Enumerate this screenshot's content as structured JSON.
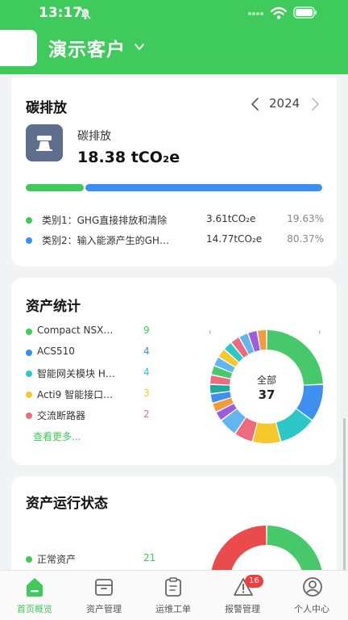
{
  "status_bar": {
    "time": "13:17",
    "icons": [
      "bell-off-icon",
      "signal-dots-icon",
      "wifi-icon",
      "battery-icon"
    ]
  },
  "header": {
    "org_name": "演示客户",
    "bg_color": "#3fcb5b"
  },
  "carbon": {
    "title": "碳排放",
    "year": "2024",
    "label": "碳排放",
    "value": "18.38 tCO₂e",
    "categories": [
      {
        "name": "类别1：GHG直接排放和清除",
        "value": "3.61tCO₂e",
        "percent": "19.63%",
        "share": 0.1963,
        "color": "#3fcb5b"
      },
      {
        "name": "类别2：输入能源产生的GH…",
        "value": "14.77tCO₂e",
        "percent": "80.37%",
        "share": 0.8037,
        "color": "#3b8ff0"
      }
    ]
  },
  "asset_stats": {
    "title": "资产统计",
    "items": [
      {
        "name": "Compact NSX…",
        "count": "9",
        "color": "#3fcb5b"
      },
      {
        "name": "ACS510",
        "count": "4",
        "color": "#3b8ff0"
      },
      {
        "name": "智能网关模块 H…",
        "count": "4",
        "color": "#2cc8c8"
      },
      {
        "name": "Acti9 智能接口…",
        "count": "3",
        "color": "#f5c82b"
      },
      {
        "name": "交流断路器",
        "count": "2",
        "color": "#ee6a7f"
      }
    ],
    "see_more": "查看更多...",
    "total_label": "全部",
    "total_value": "37",
    "donut_segments": [
      {
        "value": 9,
        "color": "#47c86a"
      },
      {
        "value": 4,
        "color": "#3d8ff0"
      },
      {
        "value": 4,
        "color": "#2cc8c8"
      },
      {
        "value": 3,
        "color": "#f5c82b"
      },
      {
        "value": 2,
        "color": "#ee6a7f"
      },
      {
        "value": 2,
        "color": "#5fb7ee"
      },
      {
        "value": 1,
        "color": "#9b5ce0"
      },
      {
        "value": 1,
        "color": "#f59a3a"
      },
      {
        "value": 1,
        "color": "#3d8ff0"
      },
      {
        "value": 1,
        "color": "#20a89c"
      },
      {
        "value": 1,
        "color": "#ee6a7f"
      },
      {
        "value": 1,
        "color": "#47c86a"
      },
      {
        "value": 1,
        "color": "#5fb7ee"
      },
      {
        "value": 1,
        "color": "#f5c82b"
      },
      {
        "value": 1,
        "color": "#2cc8c8"
      },
      {
        "value": 1,
        "color": "#ee6a7f"
      },
      {
        "value": 1,
        "color": "#5fb7ee"
      },
      {
        "value": 1,
        "color": "#9b5ce0"
      },
      {
        "value": 1,
        "color": "#f59a3a"
      }
    ]
  },
  "asset_status": {
    "title": "资产运行状态",
    "items": [
      {
        "name": "正常资产",
        "count": "21",
        "color": "#3fcb5b"
      }
    ],
    "donut_segments": [
      {
        "value": 21,
        "color": "#47c86a"
      },
      {
        "value": 16,
        "color": "#ea4b4b"
      }
    ]
  },
  "tabbar": {
    "tabs": [
      {
        "label": "首页概览",
        "icon": "home-icon",
        "active": true
      },
      {
        "label": "资产管理",
        "icon": "asset-box-icon",
        "active": false
      },
      {
        "label": "运维工单",
        "icon": "clipboard-icon",
        "active": false
      },
      {
        "label": "报警管理",
        "icon": "warning-icon",
        "active": false,
        "badge": "16"
      },
      {
        "label": "个人中心",
        "icon": "user-icon",
        "active": false
      }
    ],
    "active_color": "#3fcb5b"
  }
}
